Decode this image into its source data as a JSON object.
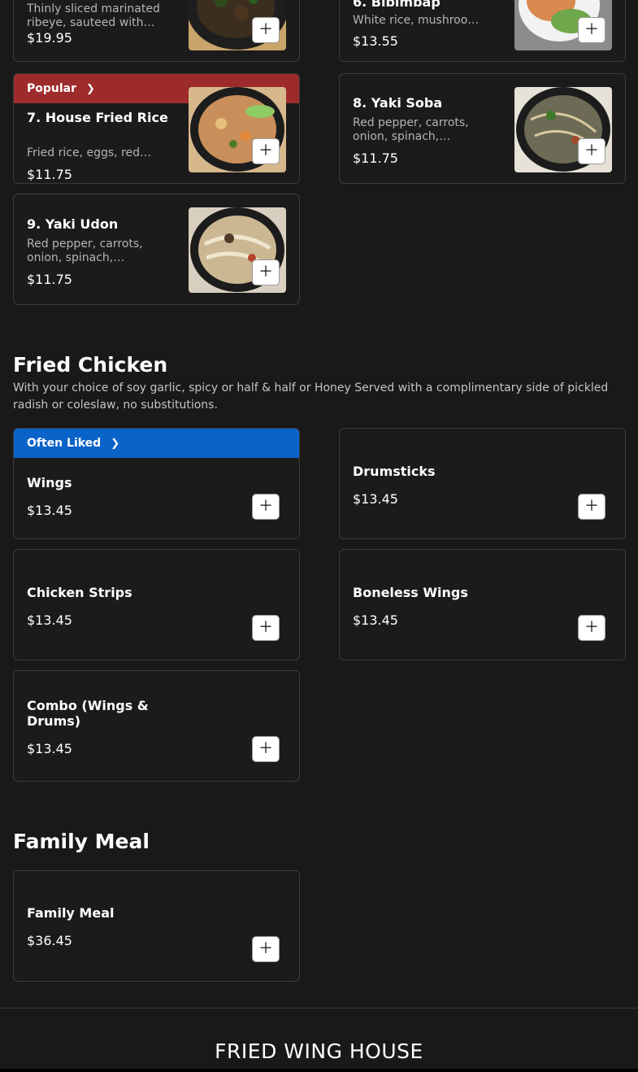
{
  "top_row": {
    "left": {
      "desc": "Thinly sliced marinated ribeye, sauteed with…",
      "price": "$19.95"
    },
    "right": {
      "name": "6. Bibimbap",
      "desc": "White rice, mushroo…",
      "price": "$13.55"
    }
  },
  "rice_noodles": {
    "items": [
      {
        "badge": "Popular",
        "name": "7. House Fried Rice",
        "desc": "Fried rice, eggs, red…",
        "price": "$11.75"
      },
      {
        "name": "8. Yaki Soba",
        "desc": "Red pepper, carrots, onion, spinach,…",
        "price": "$11.75"
      },
      {
        "name": "9. Yaki Udon",
        "desc": "Red pepper, carrots, onion, spinach,…",
        "price": "$11.75"
      }
    ]
  },
  "fried_chicken": {
    "title": "Fried Chicken",
    "description": "With your choice of soy garlic, spicy or half & half or Honey Served with a complimentary side of pickled radish or coleslaw, no substitutions.",
    "items": [
      {
        "badge": "Often Liked",
        "name": "Wings",
        "price": "$13.45"
      },
      {
        "name": "Drumsticks",
        "price": "$13.45"
      },
      {
        "name": "Chicken Strips",
        "price": "$13.45"
      },
      {
        "name": "Boneless Wings",
        "price": "$13.45"
      },
      {
        "name": "Combo (Wings & Drums)",
        "price": "$13.45"
      }
    ]
  },
  "family_meal": {
    "title": "Family Meal",
    "items": [
      {
        "name": "Family Meal",
        "price": "$36.45"
      }
    ]
  },
  "footer": {
    "brand": "FRIED WING HOUSE"
  },
  "icons": {
    "add": "plus-icon",
    "badge_arrow": "chevron-right-icon"
  },
  "colors": {
    "background": "#191919",
    "popular_badge": "#9e2b2b",
    "often_liked_badge": "#0a63c9"
  }
}
